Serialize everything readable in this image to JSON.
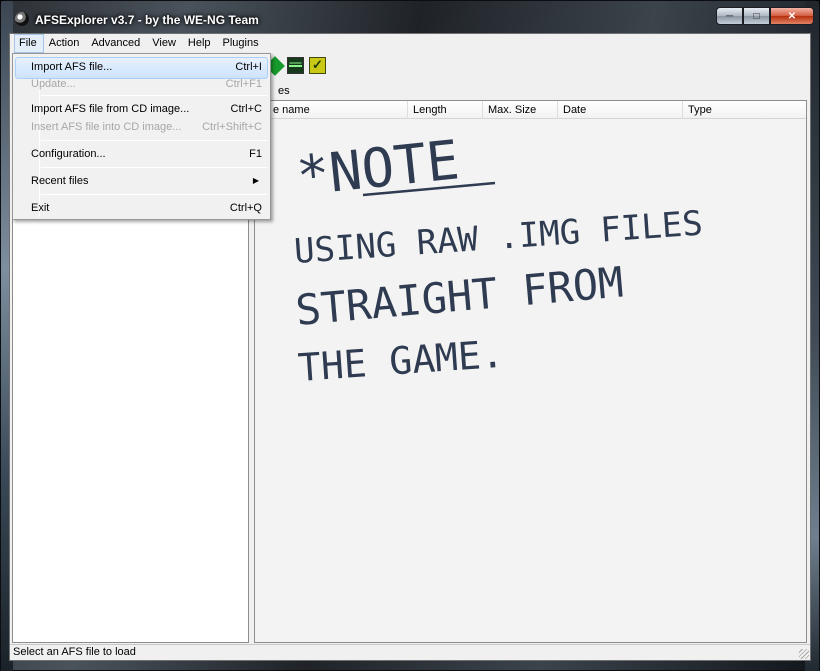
{
  "window": {
    "title": "AFSExplorer v3.7  - by the WE-NG Team",
    "minimize": "─",
    "maximize": "□",
    "close": "✕"
  },
  "menubar": [
    "File",
    "Action",
    "Advanced",
    "View",
    "Help",
    "Plugins"
  ],
  "toolbar_icons": [
    "green-diamond-icon",
    "waveform-icon",
    "check-icon"
  ],
  "section_title": "es",
  "columns": [
    "e name",
    "Length",
    "Max. Size",
    "Date",
    "Type"
  ],
  "file_menu": {
    "items": [
      {
        "label": "Import AFS file...",
        "shortcut": "Ctrl+I",
        "state": "highlighted"
      },
      {
        "label": "Update...",
        "shortcut": "Ctrl+F1",
        "state": "disabled"
      },
      {
        "label": "Import AFS file from CD image...",
        "shortcut": "Ctrl+C",
        "state": "enabled"
      },
      {
        "label": "Insert AFS file into CD image...",
        "shortcut": "Ctrl+Shift+C",
        "state": "disabled"
      },
      {
        "label": "Configuration...",
        "shortcut": "F1",
        "state": "enabled"
      },
      {
        "label": "Recent files",
        "shortcut": "▶",
        "state": "submenu"
      },
      {
        "label": "Exit",
        "shortcut": "Ctrl+Q",
        "state": "enabled"
      }
    ]
  },
  "handwritten_note": {
    "line1": "*NOTE",
    "line2": "USING RAW .IMG FILES",
    "line3": "STRAIGHT FROM",
    "line4": "THE GAME."
  },
  "status_text": "Select an AFS file to load",
  "colors": {
    "menu_highlight": "#cde3fb",
    "note_ink": "#2f3b51",
    "toolbar_green": "#179a2c"
  }
}
